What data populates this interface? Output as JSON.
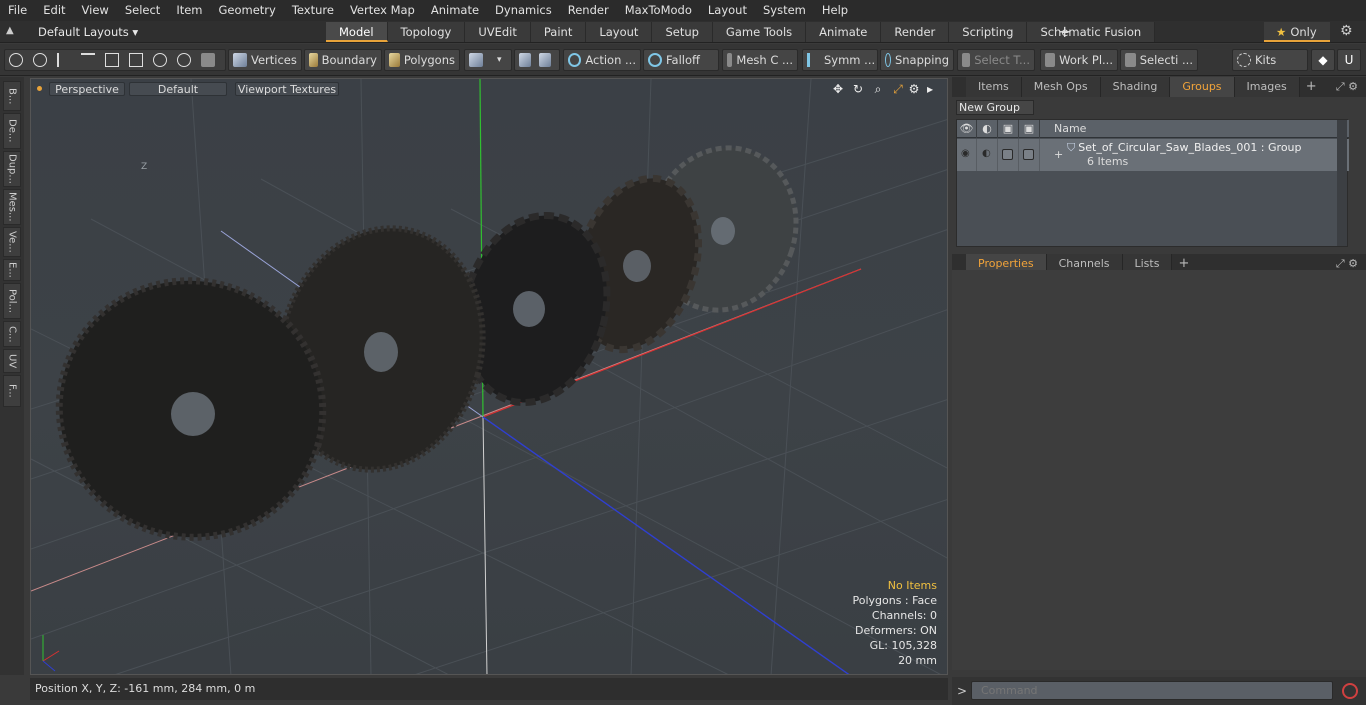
{
  "menu": [
    "File",
    "Edit",
    "View",
    "Select",
    "Item",
    "Geometry",
    "Texture",
    "Vertex Map",
    "Animate",
    "Dynamics",
    "Render",
    "MaxToModo",
    "Layout",
    "System",
    "Help"
  ],
  "layouts": {
    "label": "Default Layouts ▾"
  },
  "tabs": [
    "Model",
    "Topology",
    "UVEdit",
    "Paint",
    "Layout",
    "Setup",
    "Game Tools",
    "Animate",
    "Render",
    "Scripting",
    "Schematic Fusion"
  ],
  "active_tab": "Model",
  "only_label": "Only",
  "toolbar": {
    "vertices": "Vertices",
    "boundary": "Boundary",
    "polygons": "Polygons",
    "action": "Action ...",
    "falloff": "Falloff",
    "mesh": "Mesh C ...",
    "symm": "Symm ...",
    "snapping": "Snapping",
    "select_t": "Select T...",
    "work_pl": "Work Pl...",
    "selecti": "Selecti ...",
    "kits": "Kits"
  },
  "left_tabs": [
    "B...",
    "De...",
    "Dup...",
    "Mes...",
    "Ve...",
    "E...",
    "Pol...",
    "C...",
    "UV",
    "F..."
  ],
  "viewport": {
    "view": "Perspective",
    "shading": "Default",
    "textures": "Viewport Textures",
    "stats": {
      "items": "No Items",
      "polygons": "Polygons : Face",
      "channels": "Channels: 0",
      "deformers": "Deformers: ON",
      "gl": "GL: 105,328",
      "scale": "20 mm"
    },
    "axis_z": "Z"
  },
  "status": {
    "position": "Position X, Y, Z:   -161 mm, 284 mm, 0 m"
  },
  "right_top_tabs": [
    "Items",
    "Mesh Ops",
    "Shading",
    "Groups",
    "Images"
  ],
  "right_top_active": "Groups",
  "groups": {
    "new_group": "New Group",
    "name_header": "Name",
    "row": {
      "name": "Set_of_Circular_Saw_Blades_001 : Group",
      "count": "6 Items"
    }
  },
  "right_bottom_tabs": [
    "Properties",
    "Channels",
    "Lists"
  ],
  "right_bottom_active": "Properties",
  "command": {
    "placeholder": "Command"
  },
  "colors": {
    "accent": "#e8a33a",
    "axis_x": "#d83030",
    "axis_y": "#30c030",
    "axis_z": "#2f3fd0"
  }
}
